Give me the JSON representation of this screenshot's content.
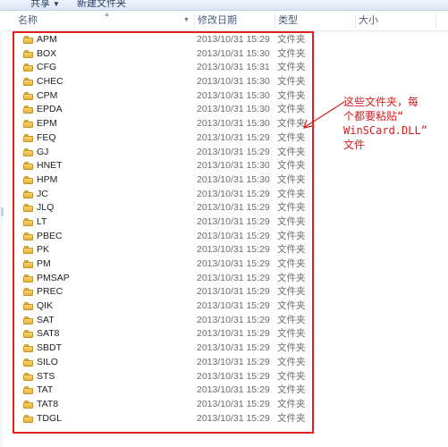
{
  "toolbar": {
    "share_label": "共享",
    "new_folder_label": "新建文件夹"
  },
  "columns": {
    "name": "名称",
    "modified": "修改日期",
    "type": "类型",
    "size": "大小"
  },
  "rows": [
    {
      "name": "APM",
      "date": "2013/10/31 15:29",
      "type": "文件夹"
    },
    {
      "name": "BOX",
      "date": "2013/10/31 15:30",
      "type": "文件夹"
    },
    {
      "name": "CFG",
      "date": "2013/10/31 15:31",
      "type": "文件夹"
    },
    {
      "name": "CHEC",
      "date": "2013/10/31 15:30",
      "type": "文件夹"
    },
    {
      "name": "CPM",
      "date": "2013/10/31 15:30",
      "type": "文件夹"
    },
    {
      "name": "EPDA",
      "date": "2013/10/31 15:30",
      "type": "文件夹"
    },
    {
      "name": "EPM",
      "date": "2013/10/31 15:30",
      "type": "文件夹"
    },
    {
      "name": "FEQ",
      "date": "2013/10/31 15:29",
      "type": "文件夹"
    },
    {
      "name": "GJ",
      "date": "2013/10/31 15:29",
      "type": "文件夹"
    },
    {
      "name": "HNET",
      "date": "2013/10/31 15:30",
      "type": "文件夹"
    },
    {
      "name": "HPM",
      "date": "2013/10/31 15:30",
      "type": "文件夹"
    },
    {
      "name": "JC",
      "date": "2013/10/31 15:29",
      "type": "文件夹"
    },
    {
      "name": "JLQ",
      "date": "2013/10/31 15:29",
      "type": "文件夹"
    },
    {
      "name": "LT",
      "date": "2013/10/31 15:29",
      "type": "文件夹"
    },
    {
      "name": "PBEC",
      "date": "2013/10/31 15:29",
      "type": "文件夹"
    },
    {
      "name": "PK",
      "date": "2013/10/31 15:29",
      "type": "文件夹"
    },
    {
      "name": "PM",
      "date": "2013/10/31 15:29",
      "type": "文件夹"
    },
    {
      "name": "PMSAP",
      "date": "2013/10/31 15:29",
      "type": "文件夹"
    },
    {
      "name": "PREC",
      "date": "2013/10/31 15:29",
      "type": "文件夹"
    },
    {
      "name": "QIK",
      "date": "2013/10/31 15:29",
      "type": "文件夹"
    },
    {
      "name": "SAT",
      "date": "2013/10/31 15:29",
      "type": "文件夹"
    },
    {
      "name": "SAT8",
      "date": "2013/10/31 15:29",
      "type": "文件夹"
    },
    {
      "name": "SBDT",
      "date": "2013/10/31 15:29",
      "type": "文件夹"
    },
    {
      "name": "SILO",
      "date": "2013/10/31 15:29",
      "type": "文件夹"
    },
    {
      "name": "STS",
      "date": "2013/10/31 15:29",
      "type": "文件夹"
    },
    {
      "name": "TAT",
      "date": "2013/10/31 15:29",
      "type": "文件夹"
    },
    {
      "name": "TAT8",
      "date": "2013/10/31 15:29",
      "type": "文件夹"
    },
    {
      "name": "TDGL",
      "date": "2013/10/31 15:29",
      "type": "文件夹"
    }
  ],
  "annotation": {
    "lines": [
      "这些文件夹，每",
      "个都要粘贴“",
      "WinSCard.DLL”",
      "文件"
    ],
    "color": "#d81c1c"
  },
  "icons": {
    "row_icon": "folder-icon",
    "share_caret": "chevron-down-icon"
  }
}
